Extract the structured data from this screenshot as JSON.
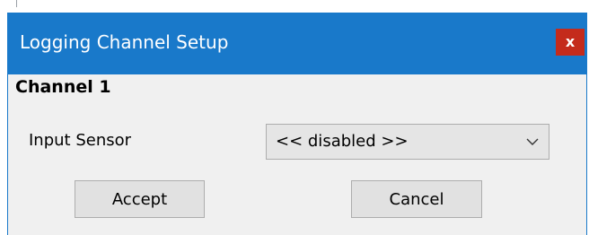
{
  "dialog": {
    "title": "Logging Channel Setup",
    "close_label": "x",
    "channel_heading": "Channel 1",
    "input_sensor": {
      "label": "Input Sensor",
      "selected_value": "<< disabled >>"
    },
    "buttons": {
      "accept": "Accept",
      "cancel": "Cancel"
    }
  },
  "icons": {
    "dropdown": "chevron-down-icon",
    "close": "close-icon"
  },
  "colors": {
    "titlebar": "#1979ca",
    "close_button": "#c42b1c",
    "dialog_body": "#f0f0f0",
    "button_face": "#e1e1e1",
    "button_border": "#adadad"
  }
}
